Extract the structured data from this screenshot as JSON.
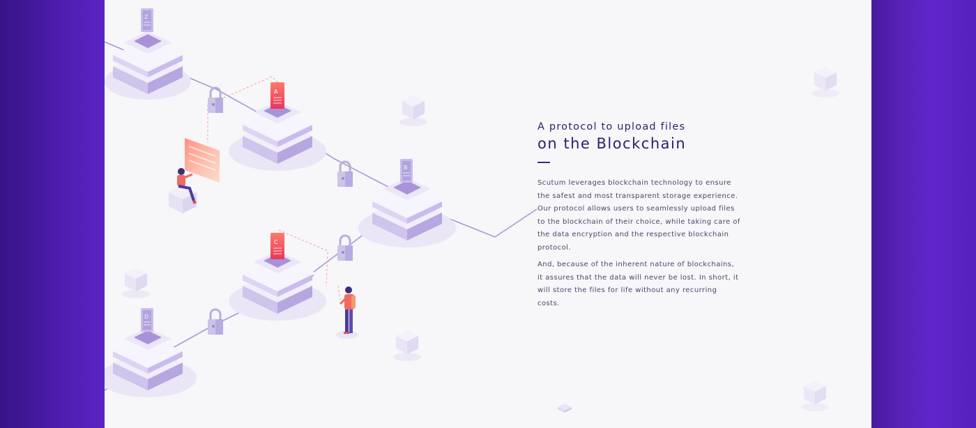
{
  "section": {
    "kicker": "A protocol to upload files",
    "title": "on the Blockchain",
    "paragraphs": [
      "Scutum leverages blockchain technology to ensure the safest and most transparent storage experience. Our protocol allows users to seamlessly upload files to the blockchain of their choice, while taking care of the data encryption and the respective blockchain protocol.",
      "And, because of the inherent nature of blockchains, it assures that the data will never be lost. In short, it will store the files for life without any recurring costs."
    ]
  },
  "illustration": {
    "file_labels": [
      "Z",
      "A",
      "B",
      "C",
      "D"
    ]
  },
  "colors": {
    "background_purple": "#5a24c4",
    "panel": "#f7f6f8",
    "heading": "#2a1f6e",
    "body_text": "#4a4668",
    "accent_red": "#f0555a",
    "lavender": "#b7a7e0"
  }
}
